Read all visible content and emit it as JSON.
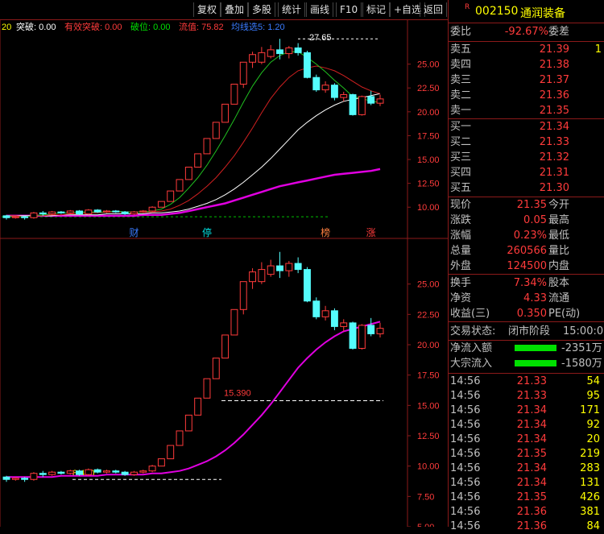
{
  "toolbar": {
    "buttons": [
      "复权",
      "叠加",
      "多股",
      "统计",
      "画线",
      "F10",
      "标记",
      "+自选",
      "返回"
    ]
  },
  "indicator_bar": {
    "prefix": "20",
    "tupo": "突破: 0.00",
    "youxiao": "有效突破: 0.00",
    "powei": "破位: 0.00",
    "liuzhi": "流值: 75.82",
    "more": "均线选5: 1.20"
  },
  "chart_data": [
    {
      "type": "candlestick",
      "title": "",
      "ylim": [
        8.5,
        27.5
      ],
      "y_ticks": [
        "25.00",
        "22.50",
        "20.00",
        "17.50",
        "15.00",
        "12.50",
        "10.00"
      ],
      "annotations": [
        "27.65"
      ],
      "event_marks": [
        "财",
        "停",
        "榜",
        "涨"
      ],
      "candles": [
        {
          "o": 9.1,
          "c": 8.9,
          "h": 9.2,
          "l": 8.7,
          "up": false
        },
        {
          "o": 8.9,
          "c": 9.0,
          "h": 9.1,
          "l": 8.8,
          "up": true
        },
        {
          "o": 9.0,
          "c": 8.9,
          "h": 9.1,
          "l": 8.7,
          "up": false
        },
        {
          "o": 8.9,
          "c": 9.4,
          "h": 9.5,
          "l": 8.8,
          "up": true
        },
        {
          "o": 9.4,
          "c": 9.3,
          "h": 9.6,
          "l": 9.1,
          "up": false
        },
        {
          "o": 9.3,
          "c": 9.5,
          "h": 9.6,
          "l": 9.2,
          "up": true
        },
        {
          "o": 9.5,
          "c": 9.4,
          "h": 9.6,
          "l": 9.3,
          "up": false
        },
        {
          "o": 9.4,
          "c": 9.6,
          "h": 9.7,
          "l": 9.3,
          "up": true
        },
        {
          "o": 9.6,
          "c": 9.3,
          "h": 9.7,
          "l": 9.2,
          "up": false
        },
        {
          "o": 9.3,
          "c": 9.7,
          "h": 9.8,
          "l": 9.2,
          "up": true
        },
        {
          "o": 9.7,
          "c": 9.5,
          "h": 9.8,
          "l": 9.4,
          "up": false
        },
        {
          "o": 9.5,
          "c": 9.6,
          "h": 9.7,
          "l": 9.4,
          "up": true
        },
        {
          "o": 9.6,
          "c": 9.5,
          "h": 9.7,
          "l": 9.4,
          "up": false
        },
        {
          "o": 9.5,
          "c": 9.3,
          "h": 9.6,
          "l": 9.2,
          "up": false
        },
        {
          "o": 9.3,
          "c": 9.5,
          "h": 9.6,
          "l": 9.2,
          "up": true
        },
        {
          "o": 9.5,
          "c": 9.6,
          "h": 9.7,
          "l": 9.4,
          "up": true
        },
        {
          "o": 9.6,
          "c": 10.0,
          "h": 10.1,
          "l": 9.5,
          "up": true
        },
        {
          "o": 10.0,
          "c": 10.6,
          "h": 10.6,
          "l": 10.0,
          "up": true
        },
        {
          "o": 10.6,
          "c": 11.7,
          "h": 11.7,
          "l": 10.6,
          "up": true
        },
        {
          "o": 11.7,
          "c": 12.9,
          "h": 12.9,
          "l": 11.7,
          "up": true
        },
        {
          "o": 12.9,
          "c": 14.2,
          "h": 14.2,
          "l": 12.9,
          "up": true
        },
        {
          "o": 14.2,
          "c": 15.6,
          "h": 15.6,
          "l": 14.2,
          "up": true
        },
        {
          "o": 15.6,
          "c": 17.2,
          "h": 17.2,
          "l": 15.6,
          "up": true
        },
        {
          "o": 17.2,
          "c": 18.9,
          "h": 18.9,
          "l": 17.2,
          "up": true
        },
        {
          "o": 18.9,
          "c": 20.8,
          "h": 20.8,
          "l": 18.9,
          "up": true
        },
        {
          "o": 20.8,
          "c": 22.9,
          "h": 22.9,
          "l": 20.8,
          "up": true
        },
        {
          "o": 22.9,
          "c": 25.2,
          "h": 25.2,
          "l": 22.5,
          "up": true
        },
        {
          "o": 25.2,
          "c": 26.0,
          "h": 26.3,
          "l": 24.6,
          "up": true
        },
        {
          "o": 25.2,
          "c": 26.2,
          "h": 26.8,
          "l": 25.0,
          "up": true
        },
        {
          "o": 25.8,
          "c": 26.5,
          "h": 27.0,
          "l": 25.6,
          "up": true
        },
        {
          "o": 26.5,
          "c": 26.1,
          "h": 27.65,
          "l": 25.5,
          "up": false
        },
        {
          "o": 26.1,
          "c": 26.7,
          "h": 26.9,
          "l": 25.6,
          "up": true
        },
        {
          "o": 26.7,
          "c": 26.2,
          "h": 27.2,
          "l": 25.9,
          "up": false
        },
        {
          "o": 26.2,
          "c": 23.6,
          "h": 26.4,
          "l": 23.5,
          "up": false
        },
        {
          "o": 23.6,
          "c": 22.3,
          "h": 23.9,
          "l": 22.1,
          "up": false
        },
        {
          "o": 22.3,
          "c": 22.8,
          "h": 23.2,
          "l": 22.0,
          "up": true
        },
        {
          "o": 22.8,
          "c": 21.5,
          "h": 23.0,
          "l": 21.2,
          "up": false
        },
        {
          "o": 21.5,
          "c": 21.8,
          "h": 22.1,
          "l": 21.1,
          "up": true
        },
        {
          "o": 21.8,
          "c": 19.7,
          "h": 21.9,
          "l": 19.6,
          "up": false
        },
        {
          "o": 19.7,
          "c": 21.6,
          "h": 21.7,
          "l": 19.6,
          "up": true
        },
        {
          "o": 21.6,
          "c": 20.9,
          "h": 22.2,
          "l": 20.7,
          "up": false
        },
        {
          "o": 20.9,
          "c": 21.35,
          "h": 21.8,
          "l": 20.6,
          "up": true
        }
      ],
      "ma5": [
        9.0,
        9.0,
        9.0,
        9.1,
        9.2,
        9.3,
        9.4,
        9.4,
        9.5,
        9.5,
        9.5,
        9.5,
        9.6,
        9.5,
        9.5,
        9.5,
        9.6,
        9.8,
        10.3,
        11.0,
        12.0,
        13.1,
        14.4,
        15.9,
        17.5,
        19.2,
        21.0,
        22.7,
        24.1,
        25.2,
        25.9,
        26.3,
        26.3,
        25.7,
        25.0,
        24.2,
        23.3,
        22.5,
        21.6,
        21.4,
        21.1,
        21.0
      ],
      "ma10": [
        9.1,
        9.1,
        9.0,
        9.1,
        9.1,
        9.2,
        9.2,
        9.3,
        9.3,
        9.4,
        9.4,
        9.5,
        9.5,
        9.5,
        9.5,
        9.5,
        9.5,
        9.6,
        9.8,
        10.2,
        10.7,
        11.4,
        12.2,
        13.1,
        14.2,
        15.4,
        16.8,
        18.3,
        19.9,
        21.4,
        22.6,
        23.6,
        24.3,
        24.6,
        24.8,
        24.6,
        24.3,
        23.8,
        23.2,
        22.6,
        22.2,
        21.9
      ],
      "ma20": [
        9.1,
        9.1,
        9.1,
        9.1,
        9.1,
        9.1,
        9.2,
        9.2,
        9.2,
        9.2,
        9.2,
        9.3,
        9.3,
        9.3,
        9.3,
        9.3,
        9.4,
        9.4,
        9.5,
        9.6,
        9.8,
        10.1,
        10.4,
        10.8,
        11.3,
        11.9,
        12.6,
        13.4,
        14.2,
        15.1,
        16.1,
        17.1,
        18.1,
        18.9,
        19.6,
        20.2,
        20.7,
        21.1,
        21.3,
        21.5,
        21.7,
        21.9
      ],
      "ma60": [
        9.1,
        9.1,
        9.1,
        9.1,
        9.1,
        9.1,
        9.1,
        9.1,
        9.1,
        9.1,
        9.1,
        9.1,
        9.1,
        9.1,
        9.1,
        9.2,
        9.2,
        9.2,
        9.3,
        9.4,
        9.6,
        9.8,
        10.0,
        10.2,
        10.4,
        10.7,
        11.0,
        11.3,
        11.6,
        11.9,
        12.2,
        12.4,
        12.6,
        12.8,
        13.0,
        13.2,
        13.4,
        13.5,
        13.6,
        13.7,
        13.8,
        14.0
      ]
    },
    {
      "type": "candlestick",
      "title": "",
      "ylim": [
        5.0,
        27.5
      ],
      "y_ticks": [
        "25.00",
        "22.50",
        "20.00",
        "17.50",
        "15.00",
        "12.50",
        "10.00",
        "7.50",
        "5.00"
      ],
      "annotations": [
        "15.390",
        "8.460"
      ]
    }
  ],
  "right_panel": {
    "title_code": "002150",
    "title_name": "通润装备",
    "title_mark": "R",
    "weibi_label": "委比",
    "weibi_value": "-92.67%",
    "weicha_label": "委差",
    "sell": [
      {
        "label": "卖五",
        "price": "21.39",
        "qty": "1"
      },
      {
        "label": "卖四",
        "price": "21.38",
        "qty": ""
      },
      {
        "label": "卖三",
        "price": "21.37",
        "qty": ""
      },
      {
        "label": "卖二",
        "price": "21.36",
        "qty": ""
      },
      {
        "label": "卖一",
        "price": "21.35",
        "qty": ""
      }
    ],
    "buy": [
      {
        "label": "买一",
        "price": "21.34",
        "qty": ""
      },
      {
        "label": "买二",
        "price": "21.33",
        "qty": ""
      },
      {
        "label": "买三",
        "price": "21.32",
        "qty": ""
      },
      {
        "label": "买四",
        "price": "21.31",
        "qty": ""
      },
      {
        "label": "买五",
        "price": "21.30",
        "qty": ""
      }
    ],
    "quote": [
      {
        "l": "现价",
        "v": "21.35",
        "r": "今开"
      },
      {
        "l": "涨跌",
        "v": "0.05",
        "r": "最高"
      },
      {
        "l": "涨幅",
        "v": "0.23%",
        "r": "最低"
      },
      {
        "l": "总量",
        "v": "260566",
        "r": "量比"
      },
      {
        "l": "外盘",
        "v": "124500",
        "r": "内盘"
      }
    ],
    "stats": [
      {
        "l": "换手",
        "v": "7.34%",
        "r": "股本"
      },
      {
        "l": "净资",
        "v": "4.33",
        "r": "流通"
      },
      {
        "l": "收益(三)",
        "v": "0.350",
        "r": "PE(动)"
      }
    ],
    "trade_status_label": "交易状态:",
    "trade_status_value": "闭市阶段",
    "trade_status_time": "15:00:00",
    "flow": [
      {
        "l": "净流入额",
        "v": "-2351万"
      },
      {
        "l": "大宗流入",
        "v": "-1580万"
      }
    ],
    "ticks": [
      {
        "t": "14:56",
        "p": "21.33",
        "q": "54",
        "dir": "sell"
      },
      {
        "t": "14:56",
        "p": "21.33",
        "q": "95",
        "dir": "sell"
      },
      {
        "t": "14:56",
        "p": "21.34",
        "q": "171",
        "dir": "buy"
      },
      {
        "t": "14:56",
        "p": "21.34",
        "q": "92",
        "dir": "buy"
      },
      {
        "t": "14:56",
        "p": "21.34",
        "q": "20",
        "dir": "buy"
      },
      {
        "t": "14:56",
        "p": "21.35",
        "q": "219",
        "dir": "buy"
      },
      {
        "t": "14:56",
        "p": "21.34",
        "q": "283",
        "dir": "sell"
      },
      {
        "t": "14:56",
        "p": "21.34",
        "q": "131",
        "dir": "sell"
      },
      {
        "t": "14:56",
        "p": "21.35",
        "q": "426",
        "dir": "buy"
      },
      {
        "t": "14:56",
        "p": "21.36",
        "q": "381",
        "dir": "buy"
      },
      {
        "t": "14:56",
        "p": "21.36",
        "q": "84",
        "dir": "buy"
      }
    ]
  }
}
